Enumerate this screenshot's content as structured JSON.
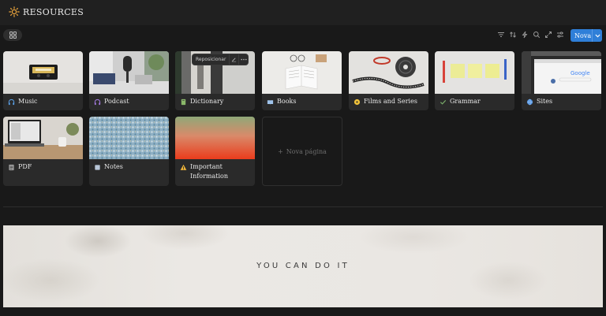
{
  "header": {
    "title": "RESOURCES",
    "icon": "sun-icon"
  },
  "toolbar": {
    "icons": [
      "filter-icon",
      "sort-icon",
      "automation-icon",
      "search-icon",
      "expand-icon",
      "settings-icon"
    ],
    "new_label": "Nova"
  },
  "cards": [
    {
      "name": "Music",
      "icon": "headphones-icon"
    },
    {
      "name": "Podcast",
      "icon": "headphones-icon"
    },
    {
      "name": "Dictionary",
      "icon": "book-icon"
    },
    {
      "name": "Books",
      "icon": "open-book-icon"
    },
    {
      "name": "Films and Series",
      "icon": "film-icon"
    },
    {
      "name": "Grammar",
      "icon": "check-icon"
    },
    {
      "name": "Sites",
      "icon": "globe-icon"
    },
    {
      "name": "PDF",
      "icon": "document-icon"
    },
    {
      "name": "Notes",
      "icon": "note-icon"
    },
    {
      "name": "Important Information",
      "icon": "warning-icon"
    }
  ],
  "hover_menu": {
    "label": "Reposicionar"
  },
  "new_page": {
    "label": "Nova página"
  },
  "banner": {
    "text": "YOU CAN DO IT"
  },
  "colors": {
    "accent": "#2f7fd8",
    "background": "#191919",
    "card": "#2a2a2a"
  }
}
